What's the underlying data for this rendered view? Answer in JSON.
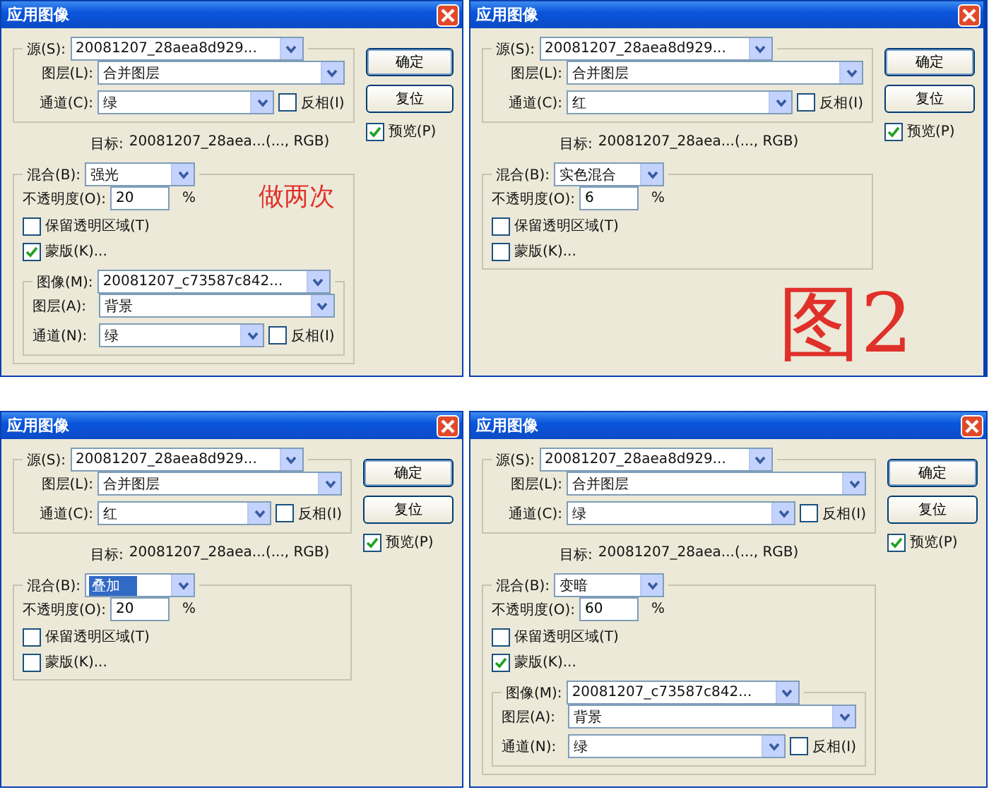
{
  "dialogs": [
    {
      "title": "应用图像",
      "source": {
        "label": "源(S):",
        "value": "20081207_28aea8d929..."
      },
      "layer": {
        "label": "图层(L):",
        "value": "合并图层"
      },
      "channel": {
        "label": "通道(C):",
        "value": "绿"
      },
      "invert": {
        "label": "反相(I)",
        "checked": false
      },
      "buttons": [
        {
          "label": "确定",
          "default": true
        },
        {
          "label": "复位",
          "default": false
        }
      ],
      "preview": {
        "label": "预览(P)",
        "checked": true
      },
      "target": {
        "label": "目标:",
        "value": "20081207_28aea...(..., RGB)"
      },
      "blend": {
        "label": "混合(B):",
        "value": "强光",
        "focused": false
      },
      "opacity": {
        "label": "不透明度(O):",
        "value": "20",
        "unit": "%"
      },
      "preserve": {
        "label": "保留透明区域(T)",
        "checked": false
      },
      "mask": {
        "label": "蒙版(K)...",
        "checked": true
      },
      "mask_group": {
        "image": {
          "label": "图像(M):",
          "value": "20081207_c73587c842..."
        },
        "layer": {
          "label": "图层(A):",
          "value": "背景"
        },
        "channel": {
          "label": "通道(N):",
          "value": "绿"
        },
        "invert": {
          "label": "反相(I)",
          "checked": false
        }
      },
      "annotation": {
        "text": "做两次",
        "kind": "small"
      }
    },
    {
      "title": "应用图像",
      "source": {
        "label": "源(S):",
        "value": "20081207_28aea8d929..."
      },
      "layer": {
        "label": "图层(L):",
        "value": "合并图层"
      },
      "channel": {
        "label": "通道(C):",
        "value": "红"
      },
      "invert": {
        "label": "反相(I)",
        "checked": false
      },
      "buttons": [
        {
          "label": "确定",
          "default": true
        },
        {
          "label": "复位",
          "default": false
        }
      ],
      "preview": {
        "label": "预览(P)",
        "checked": true
      },
      "target": {
        "label": "目标:",
        "value": "20081207_28aea...(..., RGB)"
      },
      "blend": {
        "label": "混合(B):",
        "value": "实色混合",
        "focused": false
      },
      "opacity": {
        "label": "不透明度(O):",
        "value": "6",
        "unit": "%"
      },
      "preserve": {
        "label": "保留透明区域(T)",
        "checked": false
      },
      "mask": {
        "label": "蒙版(K)...",
        "checked": false
      },
      "annotation": {
        "text": "图2",
        "kind": "large"
      }
    },
    {
      "title": "应用图像",
      "source": {
        "label": "源(S):",
        "value": "20081207_28aea8d929..."
      },
      "layer": {
        "label": "图层(L):",
        "value": "合并图层"
      },
      "channel": {
        "label": "通道(C):",
        "value": "红"
      },
      "invert": {
        "label": "反相(I)",
        "checked": false
      },
      "buttons": [
        {
          "label": "确定",
          "default": true
        },
        {
          "label": "复位",
          "default": false
        }
      ],
      "preview": {
        "label": "预览(P)",
        "checked": true
      },
      "target": {
        "label": "目标:",
        "value": "20081207_28aea...(..., RGB)"
      },
      "blend": {
        "label": "混合(B):",
        "value": "叠加",
        "focused": true
      },
      "opacity": {
        "label": "不透明度(O):",
        "value": "20",
        "unit": "%"
      },
      "preserve": {
        "label": "保留透明区域(T)",
        "checked": false
      },
      "mask": {
        "label": "蒙版(K)...",
        "checked": false
      }
    },
    {
      "title": "应用图像",
      "source": {
        "label": "源(S):",
        "value": "20081207_28aea8d929..."
      },
      "layer": {
        "label": "图层(L):",
        "value": "合并图层"
      },
      "channel": {
        "label": "通道(C):",
        "value": "绿"
      },
      "invert": {
        "label": "反相(I)",
        "checked": false
      },
      "buttons": [
        {
          "label": "确定",
          "default": true
        },
        {
          "label": "复位",
          "default": false
        }
      ],
      "preview": {
        "label": "预览(P)",
        "checked": true
      },
      "target": {
        "label": "目标:",
        "value": "20081207_28aea...(..., RGB)"
      },
      "blend": {
        "label": "混合(B):",
        "value": "变暗",
        "focused": false
      },
      "opacity": {
        "label": "不透明度(O):",
        "value": "60",
        "unit": "%"
      },
      "preserve": {
        "label": "保留透明区域(T)",
        "checked": false
      },
      "mask": {
        "label": "蒙版(K)...",
        "checked": true
      },
      "mask_group": {
        "image": {
          "label": "图像(M):",
          "value": "20081207_c73587c842..."
        },
        "layer": {
          "label": "图层(A):",
          "value": "背景"
        },
        "channel": {
          "label": "通道(N):",
          "value": "绿"
        },
        "invert": {
          "label": "反相(I)",
          "checked": false
        }
      }
    }
  ]
}
